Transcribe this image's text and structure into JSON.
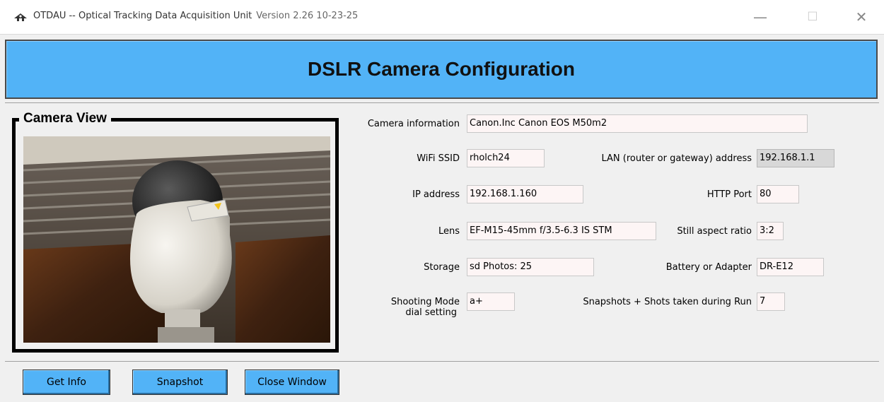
{
  "window": {
    "title": "OTDAU -- Optical Tracking Data Acquisition Unit",
    "version": "Version 2.26 10-23-25",
    "minimize_glyph": "—",
    "maximize_glyph": "☐",
    "close_glyph": "✕",
    "icon": "telescope-icon"
  },
  "header": {
    "title": "DSLR Camera Configuration"
  },
  "camera_view": {
    "legend": "Camera View"
  },
  "fields": {
    "camera_info": {
      "label": "Camera information",
      "value": "Canon.Inc  Canon EOS M50m2"
    },
    "wifi_ssid": {
      "label": "WiFi SSID",
      "value": "rholch24"
    },
    "lan_address": {
      "label": "LAN (router or gateway) address",
      "value": "192.168.1.1"
    },
    "ip_address": {
      "label": "IP address",
      "value": "192.168.1.160"
    },
    "http_port": {
      "label": "HTTP Port",
      "value": "80"
    },
    "lens": {
      "label": "Lens",
      "value": "EF-M15-45mm f/3.5-6.3 IS STM"
    },
    "aspect_ratio": {
      "label": "Still aspect ratio",
      "value": "3:2"
    },
    "storage": {
      "label": "Storage",
      "value": "sd  Photos: 25"
    },
    "battery": {
      "label": "Battery or Adapter",
      "value": "DR-E12"
    },
    "shooting_mode": {
      "label_line1": "Shooting Mode",
      "label_line2": "dial setting",
      "value": "a+"
    },
    "snapshots": {
      "label": "Snapshots + Shots taken during Run",
      "value": "7"
    }
  },
  "buttons": {
    "get_info": "Get Info",
    "snapshot": "Snapshot",
    "close_window": "Close Window"
  },
  "colors": {
    "accent": "#52b3f7",
    "field_bg": "#fdf5f5",
    "readonly_bg": "#d8d8d8"
  }
}
